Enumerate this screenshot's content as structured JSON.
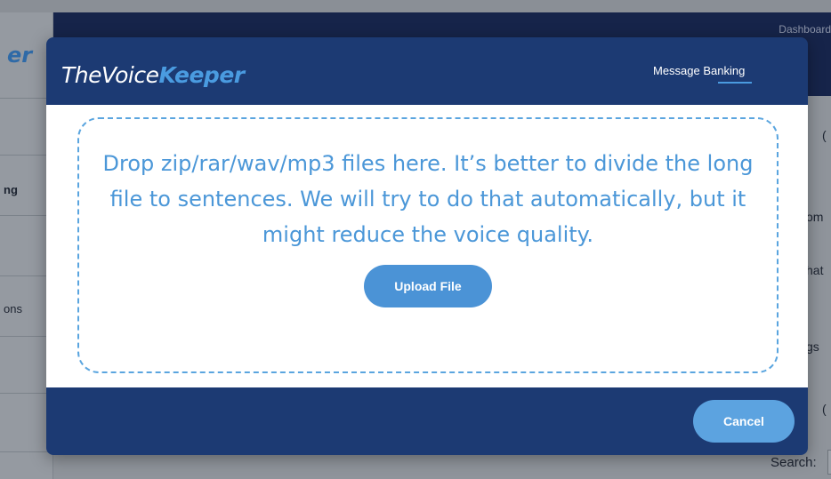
{
  "background": {
    "sidebar": {
      "logo_fragment": "er",
      "items": [
        {
          "label": "ng"
        },
        {
          "label": "ons"
        }
      ]
    },
    "header": {
      "dashboard_link": "Dashboard"
    },
    "content_fragments": [
      "om",
      "hat",
      "gs",
      "(",
      "("
    ],
    "search_label": "Search:"
  },
  "modal": {
    "brand": {
      "part1": "TheVoice",
      "part2": "Keeper"
    },
    "nav": {
      "message_banking": "Message Banking"
    },
    "dropzone": {
      "instructions": "Drop zip/rar/wav/mp3 files here. It’s better to divide the long file to sentences. We will try to do that automatically, but it might reduce the voice quality."
    },
    "upload_button": "Upload File",
    "cancel_button": "Cancel"
  },
  "colors": {
    "navy": "#1c3a73",
    "accent_blue": "#4b93d6",
    "dropzone_border": "#5aa5df"
  }
}
